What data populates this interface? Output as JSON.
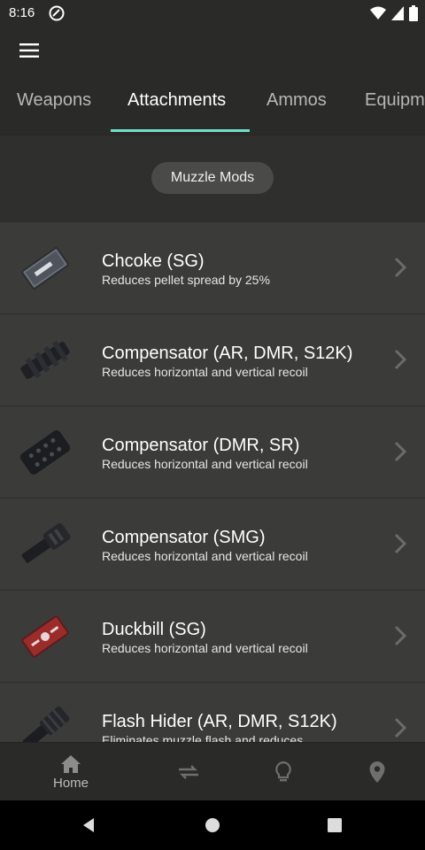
{
  "status": {
    "time": "8:16"
  },
  "tabs": [
    {
      "label": "Weapons"
    },
    {
      "label": "Attachments"
    },
    {
      "label": "Ammos"
    },
    {
      "label": "Equipm"
    }
  ],
  "filter": {
    "chip_label": "Muzzle Mods"
  },
  "items": [
    {
      "title": "Chcoke (SG)",
      "desc": "Reduces pellet spread by 25%"
    },
    {
      "title": "Compensator (AR, DMR, S12K)",
      "desc": "Reduces horizontal and vertical recoil"
    },
    {
      "title": "Compensator (DMR, SR)",
      "desc": "Reduces horizontal and vertical recoil"
    },
    {
      "title": "Compensator (SMG)",
      "desc": "Reduces horizontal and vertical recoil"
    },
    {
      "title": "Duckbill (SG)",
      "desc": "Reduces horizontal and vertical recoil"
    },
    {
      "title": "Flash Hider (AR, DMR, S12K)",
      "desc": "Eliminates muzzle flash and reduces"
    }
  ],
  "bottom_nav": {
    "home_label": "Home"
  },
  "colors": {
    "accent": "#6fe0c8",
    "background": "#2a2a29",
    "list_bg": "#3b3b3a"
  }
}
